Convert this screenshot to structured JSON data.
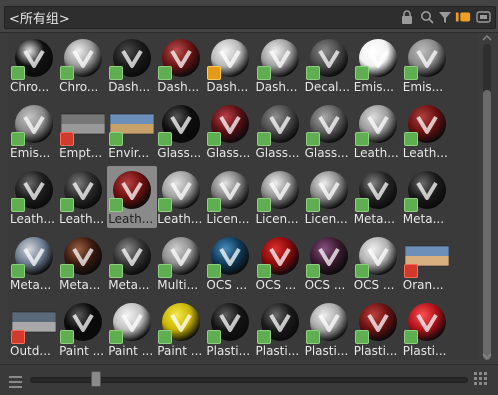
{
  "header": {
    "title": "<所有组>",
    "buttons": [
      {
        "name": "lock-icon",
        "glyph": "🔒"
      },
      {
        "name": "search-icon",
        "glyph": "🔍"
      },
      {
        "name": "filter-icon",
        "glyph": "▼"
      },
      {
        "name": "toggle-view-icon",
        "glyph": "▮"
      },
      {
        "name": "tag-icon",
        "glyph": "▭"
      }
    ]
  },
  "items": [
    {
      "label": "Chro...",
      "ball": "#111111",
      "highlight": "#e8e8e8",
      "badge": "green",
      "kind": "ball"
    },
    {
      "label": "Chro...",
      "ball": "#9a9a9a",
      "highlight": "#f0f0f0",
      "badge": "green",
      "kind": "ball"
    },
    {
      "label": "Dash...",
      "ball": "#1a1a1a",
      "highlight": "#4a4a4a",
      "badge": "green",
      "kind": "ball"
    },
    {
      "label": "Dash...",
      "ball": "#6b1414",
      "highlight": "#c05050",
      "badge": "green",
      "kind": "ball"
    },
    {
      "label": "Dash...",
      "ball": "#b8b8b8",
      "highlight": "#f4f4f4",
      "badge": "orange",
      "kind": "ball"
    },
    {
      "label": "Dash...",
      "ball": "#a0a0a0",
      "highlight": "#f0f0f0",
      "badge": "green",
      "kind": "ball"
    },
    {
      "label": "Decal...",
      "ball": "#4a4a4a",
      "highlight": "#8a8a8a",
      "badge": "green",
      "kind": "ball"
    },
    {
      "label": "Emis...",
      "ball": "#f2f2f2",
      "highlight": "#ffffff",
      "badge": "green",
      "kind": "ball"
    },
    {
      "label": "Emis...",
      "ball": "#8a8a8a",
      "highlight": "#bcbcbc",
      "badge": "green",
      "kind": "ball"
    },
    {
      "label": "Emis...",
      "ball": "#8a8a8a",
      "highlight": "#c4c4c4",
      "badge": "green",
      "kind": "ball"
    },
    {
      "label": "Empt...",
      "ball": "#777777",
      "highlight": "#999999",
      "badge": "red",
      "kind": "scene"
    },
    {
      "label": "Envir...",
      "ball": "#6b8fb8",
      "highlight": "#c8a06a",
      "badge": "green",
      "kind": "scene"
    },
    {
      "label": "Glass...",
      "ball": "#0d0d0d",
      "highlight": "#555555",
      "badge": "green",
      "kind": "ball"
    },
    {
      "label": "Glass...",
      "ball": "#5a0f14",
      "highlight": "#c04048",
      "badge": "green",
      "kind": "ball"
    },
    {
      "label": "Glass...",
      "ball": "#4a4a4a",
      "highlight": "#909090",
      "badge": "green",
      "kind": "ball"
    },
    {
      "label": "Glass...",
      "ball": "#5e5e5e",
      "highlight": "#a8a8a8",
      "badge": "green",
      "kind": "ball"
    },
    {
      "label": "Leath...",
      "ball": "#9a9a9a",
      "highlight": "#dcdcdc",
      "badge": "green",
      "kind": "ball"
    },
    {
      "label": "Leath...",
      "ball": "#6a1010",
      "highlight": "#b04040",
      "badge": "green",
      "kind": "ball"
    },
    {
      "label": "Leath...",
      "ball": "#1e1e1e",
      "highlight": "#6a6a6a",
      "badge": "green",
      "kind": "ball"
    },
    {
      "label": "Leath...",
      "ball": "#2a2a2a",
      "highlight": "#7a7a7a",
      "badge": "green",
      "kind": "ball"
    },
    {
      "label": "Leath...",
      "ball": "#6e1010",
      "highlight": "#b84040",
      "badge": "green",
      "kind": "ball",
      "selected": true
    },
    {
      "label": "Leath...",
      "ball": "#9e9e9e",
      "highlight": "#e0e0e0",
      "badge": "green",
      "kind": "ball"
    },
    {
      "label": "Licen...",
      "ball": "#7c7c7c",
      "highlight": "#e2e2e2",
      "badge": "green",
      "kind": "ball"
    },
    {
      "label": "Licen...",
      "ball": "#8a8a8a",
      "highlight": "#f0f0f0",
      "badge": "green",
      "kind": "ball"
    },
    {
      "label": "Licen...",
      "ball": "#8a8a8a",
      "highlight": "#ececec",
      "badge": "green",
      "kind": "ball"
    },
    {
      "label": "Meta...",
      "ball": "#242424",
      "highlight": "#808080",
      "badge": "green",
      "kind": "ball"
    },
    {
      "label": "Meta...",
      "ball": "#1a1a1a",
      "highlight": "#6a6a6a",
      "badge": "green",
      "kind": "ball"
    },
    {
      "label": "Meta...",
      "ball": "#6a7a90",
      "highlight": "#d8d8d8",
      "badge": "green",
      "kind": "ball"
    },
    {
      "label": "Meta...",
      "ball": "#3a1a10",
      "highlight": "#9a6040",
      "badge": "green",
      "kind": "ball"
    },
    {
      "label": "Meta...",
      "ball": "#353535",
      "highlight": "#8a8a8a",
      "badge": "green",
      "kind": "ball"
    },
    {
      "label": "Multi...",
      "ball": "#8c8c8c",
      "highlight": "#cfcfcf",
      "badge": "green",
      "kind": "ball"
    },
    {
      "label": "OCS ...",
      "ball": "#0f3a5a",
      "highlight": "#4a90c0",
      "badge": "green",
      "kind": "ball"
    },
    {
      "label": "OCS ...",
      "ball": "#8a0a0a",
      "highlight": "#e03030",
      "badge": "green",
      "kind": "ball"
    },
    {
      "label": "OCS ...",
      "ball": "#3a1a30",
      "highlight": "#8a5080",
      "badge": "green",
      "kind": "ball"
    },
    {
      "label": "OCS ...",
      "ball": "#b0b0b0",
      "highlight": "#f0f0f0",
      "badge": "green",
      "kind": "ball"
    },
    {
      "label": "Oran...",
      "ball": "#6b8fb8",
      "highlight": "#d8b080",
      "badge": "red",
      "kind": "scene"
    },
    {
      "label": "Outd...",
      "ball": "#5a6a7a",
      "highlight": "#a8a8a8",
      "badge": "red",
      "kind": "scene"
    },
    {
      "label": "Paint ...",
      "ball": "#0a0a0a",
      "highlight": "#5a5a5a",
      "badge": "green",
      "kind": "ball"
    },
    {
      "label": "Paint ...",
      "ball": "#c0c0c0",
      "highlight": "#f4f4f4",
      "badge": "green",
      "kind": "ball"
    },
    {
      "label": "Paint ...",
      "ball": "#c8b400",
      "highlight": "#f4ea50",
      "badge": "green",
      "kind": "ball"
    },
    {
      "label": "Plasti...",
      "ball": "#141414",
      "highlight": "#606060",
      "badge": "green",
      "kind": "ball"
    },
    {
      "label": "Plasti...",
      "ball": "#1a1a1a",
      "highlight": "#6a6a6a",
      "badge": "green",
      "kind": "ball"
    },
    {
      "label": "Plasti...",
      "ball": "#a8a8a8",
      "highlight": "#ececec",
      "badge": "green",
      "kind": "ball"
    },
    {
      "label": "Plasti...",
      "ball": "#6a1010",
      "highlight": "#c04040",
      "badge": "green",
      "kind": "ball"
    },
    {
      "label": "Plasti...",
      "ball": "#b0101a",
      "highlight": "#ff5050",
      "badge": "green",
      "kind": "ball"
    }
  ],
  "footer": {
    "zoom_value": 0.15
  }
}
